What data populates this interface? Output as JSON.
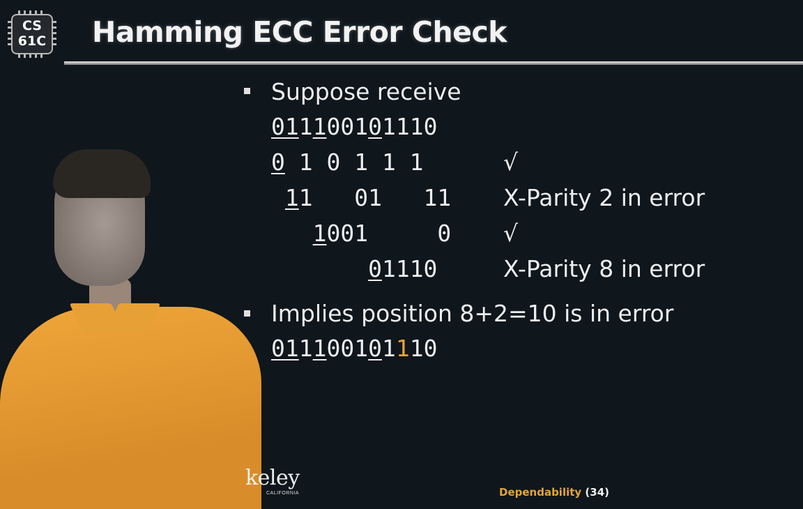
{
  "logo": {
    "line1": "CS",
    "line2": "61C"
  },
  "title": "Hamming ECC Error Check",
  "bullet1": "Suppose receive",
  "received": {
    "segments": [
      {
        "t": "01",
        "u": true
      },
      {
        "t": "1",
        "u": false
      },
      {
        "t": "1",
        "u": true
      },
      {
        "t": "001",
        "u": false
      },
      {
        "t": "0",
        "u": true
      },
      {
        "t": "1110",
        "u": false
      }
    ]
  },
  "checks": [
    {
      "pad": "",
      "segments": [
        {
          "t": "0",
          "u": true
        },
        {
          "t": " 1 0 1 1 1",
          "u": false
        }
      ],
      "result": "√"
    },
    {
      "pad": " ",
      "segments": [
        {
          "t": "1",
          "u": true
        },
        {
          "t": "1   01   11",
          "u": false
        }
      ],
      "result": "X-Parity 2 in error"
    },
    {
      "pad": "   ",
      "segments": [
        {
          "t": "1",
          "u": true
        },
        {
          "t": "001     0",
          "u": false
        }
      ],
      "result": "√"
    },
    {
      "pad": "       ",
      "segments": [
        {
          "t": "0",
          "u": true
        },
        {
          "t": "1110",
          "u": false
        }
      ],
      "result": "X-Parity 8 in error"
    }
  ],
  "bullet2": "Implies position 8+2=10 is in error",
  "corrected": {
    "segments": [
      {
        "t": "01",
        "u": true
      },
      {
        "t": "1",
        "u": false
      },
      {
        "t": "1",
        "u": true
      },
      {
        "t": "001",
        "u": false
      },
      {
        "t": "0",
        "u": true
      },
      {
        "t": "1",
        "u": false
      },
      {
        "t": "1",
        "hl": true
      },
      {
        "t": "10",
        "u": false
      }
    ]
  },
  "berkeley": {
    "word": "keley",
    "sub": "CALIFORNIA"
  },
  "footer": {
    "section": "Dependability",
    "page": "(34)"
  },
  "colors": {
    "background": "#0f161c",
    "highlight": "#e8a33a",
    "text": "#eeeeee"
  }
}
